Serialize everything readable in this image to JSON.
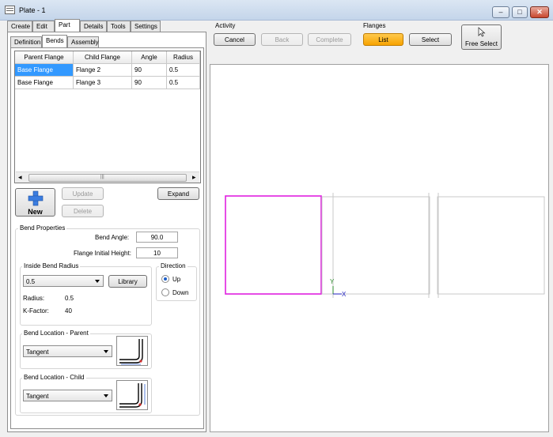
{
  "window": {
    "title": "Plate - 1",
    "min_glyph": "–",
    "max_glyph": "□",
    "close_glyph": "✕"
  },
  "main_tabs": [
    "Create",
    "Edit",
    "Part",
    "Details",
    "Tools",
    "Settings"
  ],
  "sub_tabs": [
    "Definition",
    "Bends",
    "Assembly"
  ],
  "activity": {
    "label": "Activity",
    "cancel": "Cancel",
    "back": "Back",
    "complete": "Complete"
  },
  "flanges": {
    "label": "Flanges",
    "list": "List",
    "select": "Select"
  },
  "free_select": "Free Select",
  "table": {
    "columns": [
      "Parent Flange",
      "Child Flange",
      "Angle",
      "Radius"
    ],
    "rows": [
      [
        "Base Flange",
        "Flange 2",
        "90",
        "0.5"
      ],
      [
        "Base Flange",
        "Flange 3",
        "90",
        "0.5"
      ]
    ],
    "scroll_left": "◂",
    "scroll_right": "▸",
    "scroll_grip": "|||"
  },
  "actions": {
    "new": "New",
    "update": "Update",
    "delete": "Delete",
    "expand": "Expand"
  },
  "bend_properties": {
    "label": "Bend Properties",
    "bend_angle_label": "Bend Angle:",
    "bend_angle_value": "90.0",
    "initial_height_label": "Flange Initial Height:",
    "initial_height_value": "10"
  },
  "inside_radius": {
    "label": "Inside Bend Radius",
    "selected": "0.5",
    "library": "Library",
    "radius_label": "Radius:",
    "radius_value": "0.5",
    "kfactor_label": "K-Factor:",
    "kfactor_value": "40"
  },
  "direction": {
    "label": "Direction",
    "up": "Up",
    "down": "Down",
    "selected": "Up"
  },
  "bend_location_parent": {
    "label": "Bend Location - Parent",
    "selected": "Tangent"
  },
  "bend_location_child": {
    "label": "Bend Location - Child",
    "selected": "Tangent"
  },
  "viewport": {
    "axis_y": "Y",
    "axis_x": "X"
  },
  "colors": {
    "selection": "#3399ff",
    "highlight_flange": "#e020e0",
    "list_button": "#f7a300",
    "axis_y": "#2e8b2e",
    "axis_x": "#2020c0"
  }
}
